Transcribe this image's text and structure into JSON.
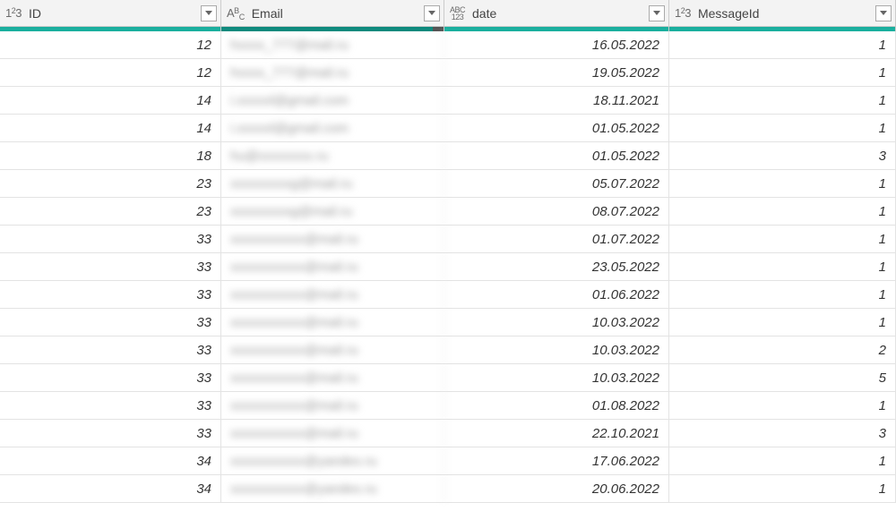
{
  "columns": [
    {
      "name": "ID",
      "typeIcon": "int"
    },
    {
      "name": "Email",
      "typeIcon": "text"
    },
    {
      "name": "date",
      "typeIcon": "any"
    },
    {
      "name": "MessageId",
      "typeIcon": "int"
    }
  ],
  "rows": [
    {
      "id": "12",
      "email": "hxxxx_777@mail.ru",
      "date": "16.05.2022",
      "messageId": "1"
    },
    {
      "id": "12",
      "email": "hxxxx_777@mail.ru",
      "date": "19.05.2022",
      "messageId": "1"
    },
    {
      "id": "14",
      "email": "i.xxxxxl@gmail.com",
      "date": "18.11.2021",
      "messageId": "1"
    },
    {
      "id": "14",
      "email": "i.xxxxxl@gmail.com",
      "date": "01.05.2022",
      "messageId": "1"
    },
    {
      "id": "18",
      "email": "hu@xxxxxxxx.ru",
      "date": "01.05.2022",
      "messageId": "3"
    },
    {
      "id": "23",
      "email": "xxxxxxxxxg@mail.ru",
      "date": "05.07.2022",
      "messageId": "1"
    },
    {
      "id": "23",
      "email": "xxxxxxxxxg@mail.ru",
      "date": "08.07.2022",
      "messageId": "1"
    },
    {
      "id": "33",
      "email": "xxxxxxxxxxx@mail.ru",
      "date": "01.07.2022",
      "messageId": "1"
    },
    {
      "id": "33",
      "email": "xxxxxxxxxxx@mail.ru",
      "date": "23.05.2022",
      "messageId": "1"
    },
    {
      "id": "33",
      "email": "xxxxxxxxxxx@mail.ru",
      "date": "01.06.2022",
      "messageId": "1"
    },
    {
      "id": "33",
      "email": "xxxxxxxxxxx@mail.ru",
      "date": "10.03.2022",
      "messageId": "1"
    },
    {
      "id": "33",
      "email": "xxxxxxxxxxx@mail.ru",
      "date": "10.03.2022",
      "messageId": "2"
    },
    {
      "id": "33",
      "email": "xxxxxxxxxxx@mail.ru",
      "date": "10.03.2022",
      "messageId": "5"
    },
    {
      "id": "33",
      "email": "xxxxxxxxxxx@mail.ru",
      "date": "01.08.2022",
      "messageId": "1"
    },
    {
      "id": "33",
      "email": "xxxxxxxxxxx@mail.ru",
      "date": "22.10.2021",
      "messageId": "3"
    },
    {
      "id": "34",
      "email": "xxxxxxxxxxx@yandex.ru",
      "date": "17.06.2022",
      "messageId": "1"
    },
    {
      "id": "34",
      "email": "xxxxxxxxxxx@yandex.ru",
      "date": "20.06.2022",
      "messageId": "1"
    }
  ],
  "selectedColumnIndex": 1,
  "accentColor": "#1aaf9e"
}
